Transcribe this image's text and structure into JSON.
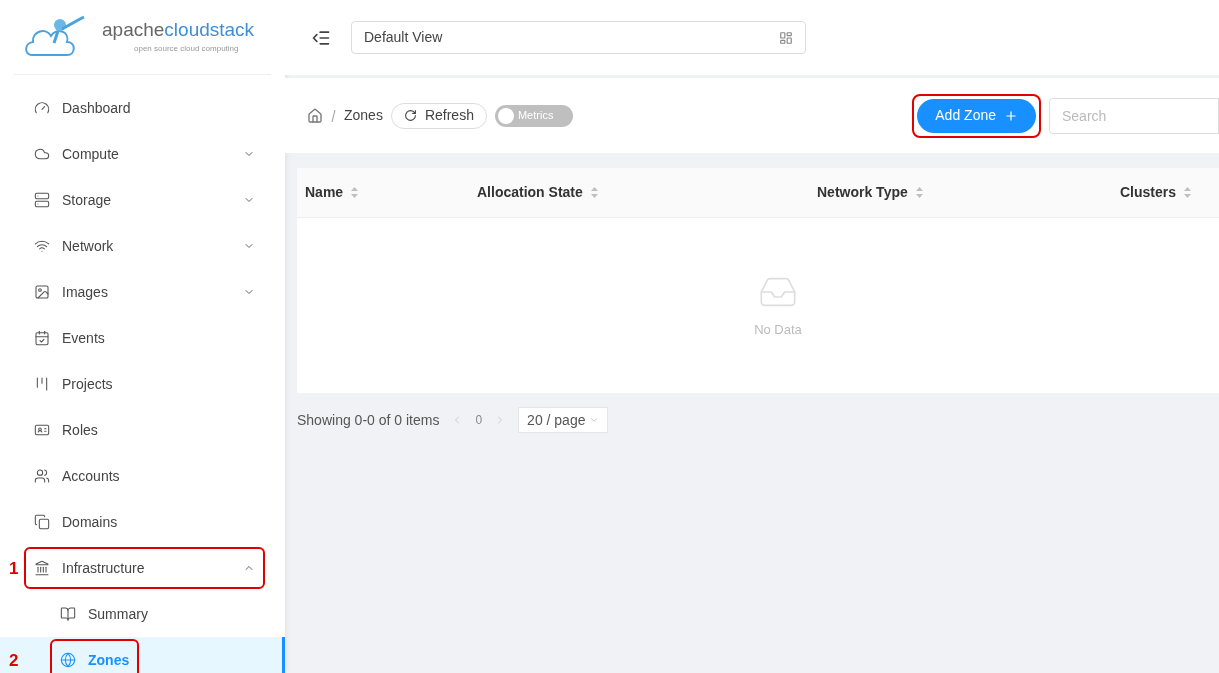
{
  "logo": {
    "name_part_1": "apache",
    "name_part_2": "cloudstack",
    "tagline": "open source cloud computing"
  },
  "sidebar": {
    "items": [
      {
        "label": "Dashboard",
        "kind": "link"
      },
      {
        "label": "Compute",
        "kind": "group",
        "expanded": false
      },
      {
        "label": "Storage",
        "kind": "group",
        "expanded": false
      },
      {
        "label": "Network",
        "kind": "group",
        "expanded": false
      },
      {
        "label": "Images",
        "kind": "group",
        "expanded": false
      },
      {
        "label": "Events",
        "kind": "link"
      },
      {
        "label": "Projects",
        "kind": "link"
      },
      {
        "label": "Roles",
        "kind": "link"
      },
      {
        "label": "Accounts",
        "kind": "link"
      },
      {
        "label": "Domains",
        "kind": "link"
      },
      {
        "label": "Infrastructure",
        "kind": "group",
        "expanded": true,
        "callout": "1",
        "children": [
          {
            "label": "Summary",
            "selected": false
          },
          {
            "label": "Zones",
            "selected": true,
            "callout": "2"
          }
        ]
      }
    ]
  },
  "topbar": {
    "view_select": "Default View"
  },
  "toolbar": {
    "breadcrumb": "Zones",
    "refresh_button": "Refresh",
    "metrics_toggle": {
      "label": "Metrics",
      "on": false
    },
    "add_button": {
      "label": "Add Zone",
      "highlighted": true
    },
    "search": {
      "placeholder": "Search"
    }
  },
  "table": {
    "columns": [
      "Name",
      "Allocation State",
      "Network Type",
      "Clusters"
    ],
    "empty_text": "No Data"
  },
  "pagination": {
    "summary": "Showing 0-0 of 0 items",
    "page": "0",
    "page_size": "20 / page"
  }
}
